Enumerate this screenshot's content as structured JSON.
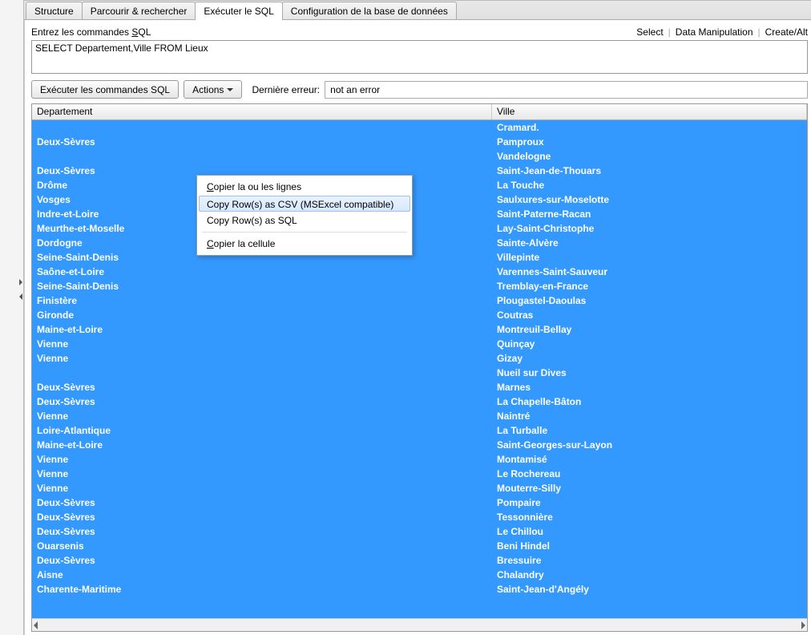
{
  "tabs": [
    {
      "label": "Structure"
    },
    {
      "label": "Parcourir & rechercher"
    },
    {
      "label": "Exécuter le SQL"
    },
    {
      "label": "Configuration de la base de données"
    }
  ],
  "sql_label_prefix": "Entrez les commandes ",
  "sql_label_u": "S",
  "sql_label_suffix": "QL",
  "sql_value": "SELECT Departement,Ville FROM Lieux",
  "right_links": {
    "select": "Select",
    "manip": "Data Manipulation",
    "create": "Create/Alt"
  },
  "exec_btn": "Exécuter les commandes SQL",
  "actions_btn": "Actions",
  "error_label": "Dernière erreur:",
  "error_value": "not an error",
  "columns": {
    "dep": "Departement",
    "ville": "Ville"
  },
  "rows": [
    {
      "dep": "",
      "ville": "Cramard."
    },
    {
      "dep": "Deux-Sèvres",
      "ville": "Pamproux"
    },
    {
      "dep": "",
      "ville": "Vandelogne"
    },
    {
      "dep": "Deux-Sèvres",
      "ville": "Saint-Jean-de-Thouars"
    },
    {
      "dep": "Drôme",
      "ville": "La Touche"
    },
    {
      "dep": "Vosges",
      "ville": "Saulxures-sur-Moselotte"
    },
    {
      "dep": "Indre-et-Loire",
      "ville": "Saint-Paterne-Racan"
    },
    {
      "dep": "Meurthe-et-Moselle",
      "ville": "Lay-Saint-Christophe"
    },
    {
      "dep": "Dordogne",
      "ville": "Sainte-Alvère"
    },
    {
      "dep": "Seine-Saint-Denis",
      "ville": "Villepinte"
    },
    {
      "dep": "Saône-et-Loire",
      "ville": "Varennes-Saint-Sauveur"
    },
    {
      "dep": "Seine-Saint-Denis",
      "ville": "Tremblay-en-France"
    },
    {
      "dep": "Finistère",
      "ville": "Plougastel-Daoulas"
    },
    {
      "dep": "Gironde",
      "ville": "Coutras"
    },
    {
      "dep": "Maine-et-Loire",
      "ville": "Montreuil-Bellay"
    },
    {
      "dep": "Vienne",
      "ville": "Quinçay"
    },
    {
      "dep": "Vienne",
      "ville": "Gizay"
    },
    {
      "dep": "",
      "ville": "Nueil sur Dives"
    },
    {
      "dep": "Deux-Sèvres",
      "ville": "Marnes"
    },
    {
      "dep": "Deux-Sèvres",
      "ville": "La Chapelle-Bâton"
    },
    {
      "dep": "Vienne",
      "ville": "Naintré"
    },
    {
      "dep": "Loire-Atlantique",
      "ville": "La Turballe"
    },
    {
      "dep": "Maine-et-Loire",
      "ville": "Saint-Georges-sur-Layon"
    },
    {
      "dep": "Vienne",
      "ville": "Montamisé"
    },
    {
      "dep": "Vienne",
      "ville": "Le Rochereau"
    },
    {
      "dep": "Vienne",
      "ville": "Mouterre-Silly"
    },
    {
      "dep": "Deux-Sèvres",
      "ville": "Pompaire"
    },
    {
      "dep": "Deux-Sèvres",
      "ville": "Tessonnière"
    },
    {
      "dep": "Deux-Sèvres",
      "ville": "Le Chillou"
    },
    {
      "dep": "Ouarsenis",
      "ville": "Beni Hindel"
    },
    {
      "dep": "Deux-Sèvres",
      "ville": "Bressuire"
    },
    {
      "dep": "Aisne",
      "ville": "Chalandry"
    },
    {
      "dep": "Charente-Maritime",
      "ville": "Saint-Jean-d'Angély"
    }
  ],
  "context_menu": {
    "copy_lines": "opier la ou les lignes",
    "copy_lines_u": "C",
    "copy_csv": "Copy Row(s) as CSV (MSExcel compatible)",
    "copy_sql": "Copy Row(s) as SQL",
    "copy_cell": "opier la cellule",
    "copy_cell_u": "C"
  }
}
